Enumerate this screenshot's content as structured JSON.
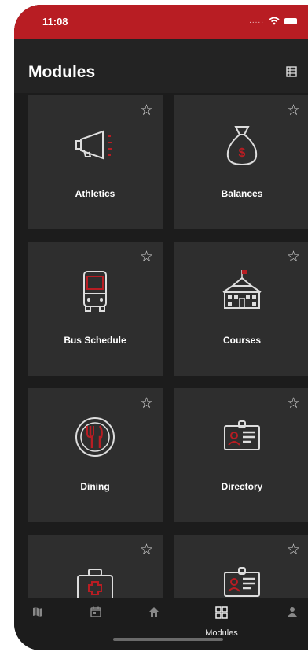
{
  "status": {
    "time": "11:08",
    "dots": "....."
  },
  "header": {
    "title": "Modules",
    "list_view_icon": "list-view-icon"
  },
  "modules": [
    {
      "label": "Athletics",
      "icon": "megaphone-icon"
    },
    {
      "label": "Balances",
      "icon": "money-bag-icon"
    },
    {
      "label": "Bus Schedule",
      "icon": "bus-icon"
    },
    {
      "label": "Courses",
      "icon": "school-building-icon"
    },
    {
      "label": "Dining",
      "icon": "dining-icon"
    },
    {
      "label": "Directory",
      "icon": "id-card-icon"
    },
    {
      "label": "",
      "icon": "first-aid-kit-icon"
    },
    {
      "label": "",
      "icon": "id-card-icon"
    }
  ],
  "tabs": [
    {
      "label": "",
      "icon": "map-icon"
    },
    {
      "label": "",
      "icon": "calendar-icon"
    },
    {
      "label": "",
      "icon": "home-icon"
    },
    {
      "label": "Modules",
      "icon": "grid-icon",
      "active": true
    },
    {
      "label": "",
      "icon": "person-icon"
    }
  ],
  "colors": {
    "accent": "#b81d23",
    "tile": "#2e2e2e",
    "background": "#1c1c1c"
  }
}
